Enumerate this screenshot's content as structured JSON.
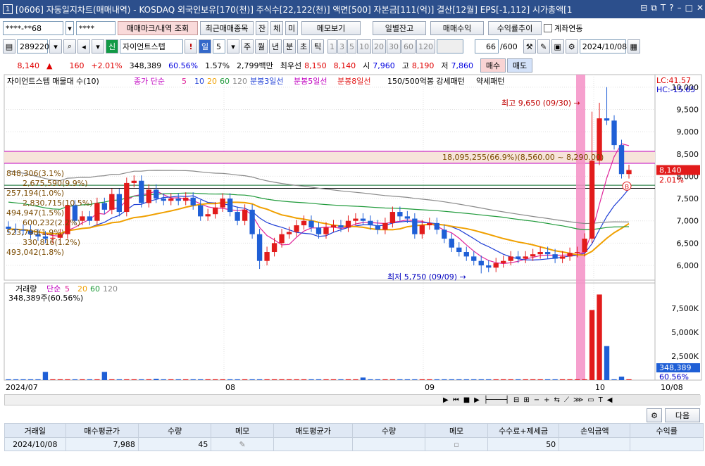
{
  "window": {
    "number": "1",
    "title": "[0606] 자동일지차트(매매내역) - KOSDAQ 외국인보유[170(천)] 주식수[22,122(천)] 액면[500] 자본금[111(억)] 결산[12월] EPS[-1,112] 시가총액[1"
  },
  "toolbar1": {
    "account": "****-**68",
    "password": "****",
    "btn_trade_mark": "매매마크/내역 조회",
    "btn_recent_items": "최근매매종목",
    "btn_jan": "잔",
    "btn_che": "체",
    "btn_mi": "미",
    "btn_memo": "메모보기",
    "btn_daily_balance": "일별잔고",
    "btn_trade_profit": "매매수익",
    "btn_profit_trend": "수익률추이",
    "chk_account_link": "계좌연동"
  },
  "toolbar2": {
    "code": "289220",
    "badge": "신",
    "stock_name": "자이언트스텝",
    "excl": "!",
    "period_sel": "일",
    "period_num": "5",
    "periods": [
      "주",
      "월",
      "년",
      "분",
      "초",
      "틱"
    ],
    "minutes": [
      "1",
      "3",
      "5",
      "10",
      "20",
      "30",
      "60",
      "120"
    ],
    "count": "66",
    "count_total": "/600",
    "date": "2024/10/08"
  },
  "price": {
    "current": "8,140",
    "arrow": "▲",
    "change": "160",
    "rate": "+2.01%",
    "volume": "348,389",
    "vol_rate": "60.56%",
    "turnover": "1.57%",
    "amount": "2,799백만",
    "best_ask_label": "최우선",
    "ask": "8,150",
    "bid": "8,140",
    "open_label": "시",
    "open": "7,960",
    "high_label": "고",
    "high": "8,190",
    "low_label": "저",
    "low": "7,860",
    "buy": "매수",
    "sell": "매도"
  },
  "legend": {
    "stock": "자이언트스텝 매물대 수(10)",
    "ma_label": "종가 단순",
    "ma_periods": [
      "5",
      "10",
      "20",
      "60",
      "120"
    ],
    "bongs": [
      "분봉3일선",
      "분봉5일선",
      "분봉8일선"
    ],
    "pattern": "150/500억봉 강세패턴",
    "weak": "약세패턴"
  },
  "chart_data": {
    "type": "candlestick",
    "price_axis": {
      "ticks": [
        "10,000",
        "9,500",
        "9,000",
        "8,500",
        "8,000",
        "7,500",
        "7,000",
        "6,500",
        "6,000"
      ],
      "lc": "LC:41.57",
      "hc": "HC:-15.65",
      "current_tag": "8,140",
      "rate_tag": "2.01%",
      "marker": "B"
    },
    "time_labels": [
      "2024/07",
      "08",
      "09",
      "10",
      "10/08"
    ],
    "annotations": {
      "high": "최고 9,650 (09/30)",
      "low": "최저 5,750 (09/09)",
      "band": "18,095,255(66.9%)(8,560.00 ~ 8,290.00)"
    },
    "volume_profile": [
      "848,306(3.1%)",
      "2,675,590(9.9%)",
      "257,194(1.0%)",
      "2,830,715(10.5%)",
      "494,947(1.5%)",
      "600,232(2.2%)",
      "523,798(1.9%)",
      "330,816(1.2%)",
      "493,042(1.8%)"
    ],
    "volume_legend": {
      "label": "거래량",
      "ma_label": "단순",
      "periods": [
        "5",
        "20",
        "60",
        "120"
      ]
    },
    "volume_value": "348,389주(60.56%)",
    "volume_axis": {
      "ticks": [
        "7,500K",
        "5,000K",
        "2,500K"
      ],
      "current_tag": "348,389",
      "rate_tag": "60.56%"
    },
    "ylim": [
      5750,
      10200
    ],
    "colors": {
      "up": "#e21b1b",
      "down": "#1f5fd6",
      "ma5": "#e0249a",
      "ma10": "#1f3fd6",
      "ma20": "#f0a000",
      "ma60": "#1f9a3a",
      "ma120": "#8a8a8a"
    }
  },
  "bottom_bar": {
    "settings_icon": "gear-icon",
    "next": "다음"
  },
  "trade_table": {
    "headers": [
      "거래일",
      "매수평균가",
      "수량",
      "메모",
      "매도평균가",
      "수량",
      "메모",
      "수수료+제세금",
      "손익금액",
      "수익률"
    ],
    "rows": [
      [
        "2024/10/08",
        "7,988",
        "45",
        "",
        "",
        "",
        "",
        "50",
        "",
        ""
      ]
    ]
  }
}
